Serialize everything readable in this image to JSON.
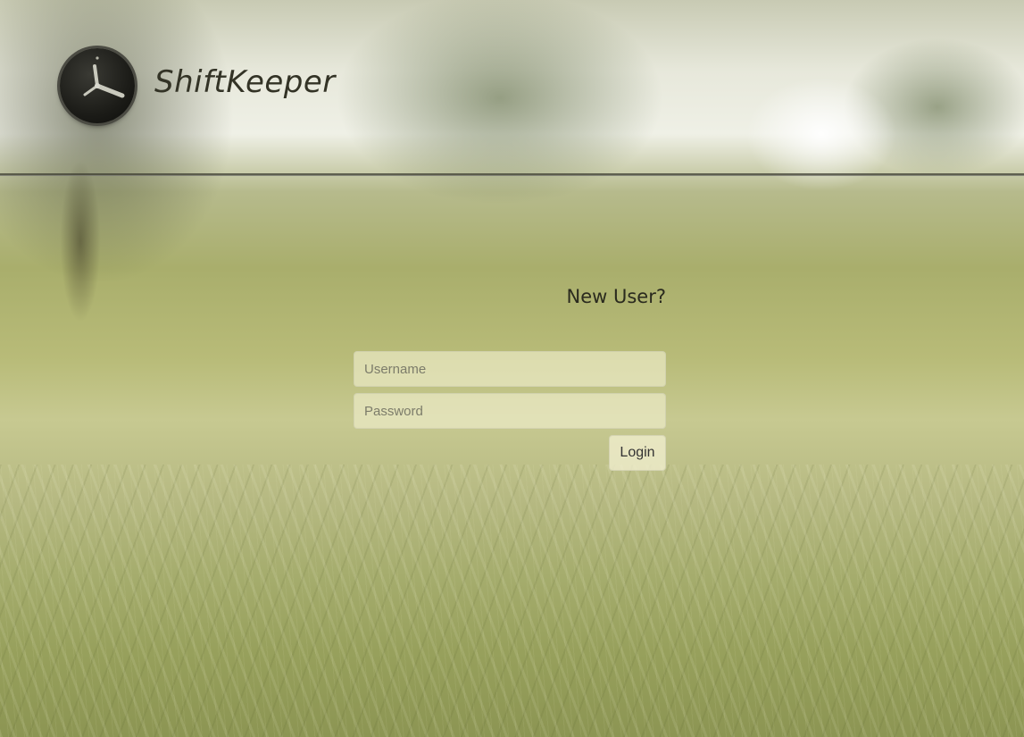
{
  "header": {
    "brand_name": "ShiftKeeper",
    "logo_icon": "clock-icon"
  },
  "login": {
    "new_user_link": "New User?",
    "username_placeholder": "Username",
    "password_placeholder": "Password",
    "login_label": "Login"
  },
  "colors": {
    "brand_text": "#333326",
    "field_background": "#f0eecd",
    "divider": "#3c3c32"
  }
}
